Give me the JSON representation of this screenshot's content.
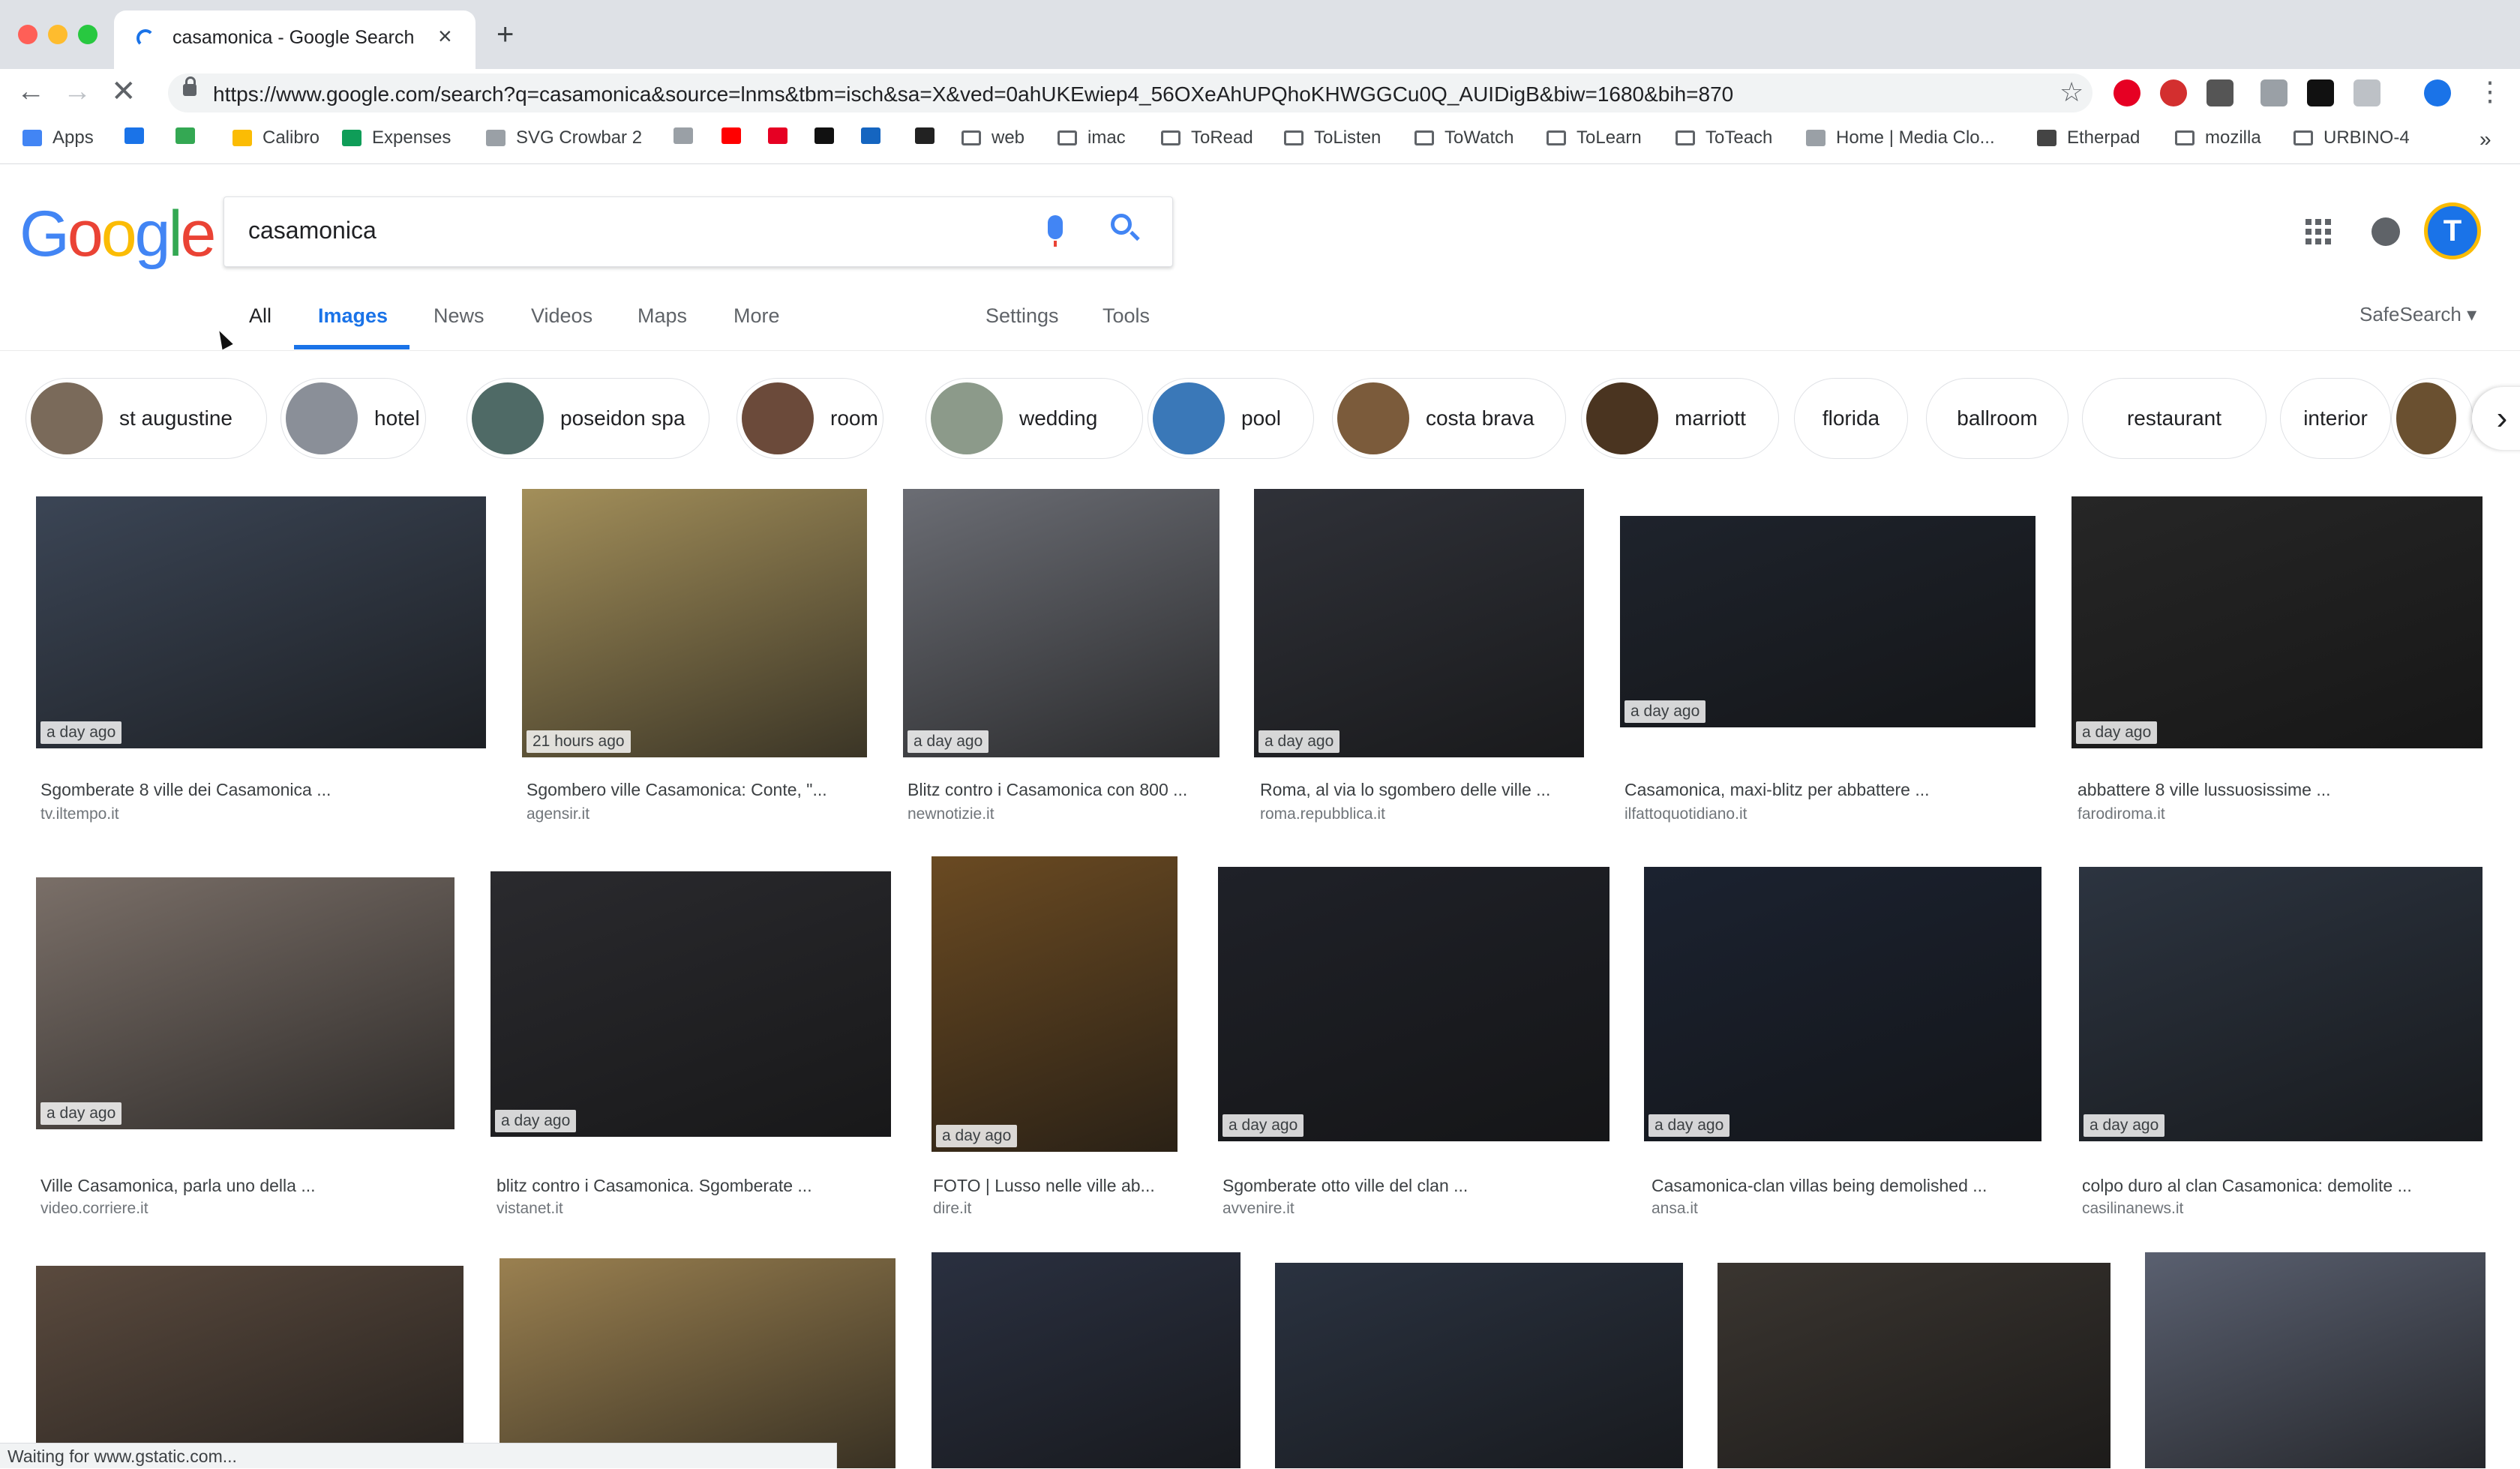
{
  "browser": {
    "tab_title": "casamonica - Google Search",
    "url": "https://www.google.com/search?q=casamonica&source=lnms&tbm=isch&sa=X&ved=0ahUKEwiep4_56OXeAhUPQhoKHWGGCu0Q_AUIDigB&biw=1680&bih=870",
    "status": "Waiting for www.gstatic.com..."
  },
  "bookmarks": [
    {
      "label": "Apps",
      "icon": "apps-grid-icon",
      "color": "#4285f4"
    },
    {
      "label": "",
      "icon": "calendar-icon",
      "color": "#1a73e8"
    },
    {
      "label": "",
      "icon": "drive-icon",
      "color": "#34a853"
    },
    {
      "label": "Calibro",
      "icon": "drive-icon",
      "color": "#fbbc04"
    },
    {
      "label": "Expenses",
      "icon": "sheets-icon",
      "color": "#0f9d58"
    },
    {
      "label": "SVG Crowbar 2",
      "icon": "page-icon",
      "color": "#9aa0a6"
    },
    {
      "label": "",
      "icon": "rss-icon",
      "color": "#9aa0a6"
    },
    {
      "label": "",
      "icon": "youtube-icon",
      "color": "#ff0000"
    },
    {
      "label": "",
      "icon": "pinterest-icon",
      "color": "#e60023"
    },
    {
      "label": "",
      "icon": "v-icon",
      "color": "#111111"
    },
    {
      "label": "",
      "icon": "t2-icon",
      "color": "#1565c0"
    },
    {
      "label": "",
      "icon": "image-icon",
      "color": "#222222"
    },
    {
      "label": "web",
      "icon": "folder-icon",
      "color": "#5f6368"
    },
    {
      "label": "imac",
      "icon": "folder-icon",
      "color": "#5f6368"
    },
    {
      "label": "ToRead",
      "icon": "folder-icon",
      "color": "#5f6368"
    },
    {
      "label": "ToListen",
      "icon": "folder-icon",
      "color": "#5f6368"
    },
    {
      "label": "ToWatch",
      "icon": "folder-icon",
      "color": "#5f6368"
    },
    {
      "label": "ToLearn",
      "icon": "folder-icon",
      "color": "#5f6368"
    },
    {
      "label": "ToTeach",
      "icon": "folder-icon",
      "color": "#5f6368"
    },
    {
      "label": "Home | Media Clo...",
      "icon": "page-icon",
      "color": "#9aa0a6"
    },
    {
      "label": "Etherpad",
      "icon": "etherpad-icon",
      "color": "#444444"
    },
    {
      "label": "mozilla",
      "icon": "folder-icon",
      "color": "#5f6368"
    },
    {
      "label": "URBINO-4",
      "icon": "folder-icon",
      "color": "#5f6368"
    }
  ],
  "bookmarks_overflow": "»",
  "search": {
    "query": "casamonica"
  },
  "logo_letters": [
    {
      "ch": "G",
      "color": "#4285f4"
    },
    {
      "ch": "o",
      "color": "#ea4335"
    },
    {
      "ch": "o",
      "color": "#fbbc05"
    },
    {
      "ch": "g",
      "color": "#4285f4"
    },
    {
      "ch": "l",
      "color": "#34a853"
    },
    {
      "ch": "e",
      "color": "#ea4335"
    }
  ],
  "avatar_letter": "T",
  "tabs": {
    "all": "All",
    "images": "Images",
    "news": "News",
    "videos": "Videos",
    "maps": "Maps",
    "more": "More",
    "settings": "Settings",
    "tools": "Tools",
    "safesearch": "SafeSearch ▾"
  },
  "chips": [
    {
      "label": "st augustine",
      "thumb": "#7a6a5a"
    },
    {
      "label": "hotel",
      "thumb": "#8a8f98"
    },
    {
      "label": "poseidon spa",
      "thumb": "#4f6a66"
    },
    {
      "label": "room",
      "thumb": "#6b4a3a"
    },
    {
      "label": "wedding",
      "thumb": "#8c9a8a"
    },
    {
      "label": "pool",
      "thumb": "#3a78b8"
    },
    {
      "label": "costa brava",
      "thumb": "#7b5b3b"
    },
    {
      "label": "marriott",
      "thumb": "#4a3420"
    },
    {
      "label": "florida",
      "thumb": ""
    },
    {
      "label": "ballroom",
      "thumb": ""
    },
    {
      "label": "restaurant",
      "thumb": ""
    },
    {
      "label": "interior",
      "thumb": ""
    },
    {
      "label": "",
      "thumb": "#6a5030"
    }
  ],
  "results": [
    {
      "time": "a day ago",
      "caption": "Sgomberate 8 ville dei Casamonica ...",
      "domain": "tv.iltempo.it",
      "color": "#3b4555"
    },
    {
      "time": "21 hours ago",
      "caption": "Sgombero ville Casamonica: Conte, \"...",
      "domain": "agensir.it",
      "color": "#a38f5a"
    },
    {
      "time": "a day ago",
      "caption": "Blitz contro i Casamonica con 800 ...",
      "domain": "newnotizie.it",
      "color": "#6b6d74"
    },
    {
      "time": "a day ago",
      "caption": "Roma, al via lo sgombero delle ville ...",
      "domain": "roma.repubblica.it",
      "color": "#2f3138"
    },
    {
      "time": "a day ago",
      "caption": "Casamonica, maxi-blitz per abbattere ...",
      "domain": "ilfattoquotidiano.it",
      "color": "#1e232c"
    },
    {
      "time": "a day ago",
      "caption": "abbattere 8 ville lussuosissime ...",
      "domain": "farodiroma.it",
      "color": "#262626"
    },
    {
      "time": "a day ago",
      "caption": "Ville Casamonica, parla uno della ...",
      "domain": "video.corriere.it",
      "color": "#7a6f68"
    },
    {
      "time": "a day ago",
      "caption": "blitz contro i Casamonica. Sgomberate ...",
      "domain": "vistanet.it",
      "color": "#2a2a2e"
    },
    {
      "time": "a day ago",
      "caption": "FOTO | Lusso nelle ville ab...",
      "domain": "dire.it",
      "color": "#6a4a22"
    },
    {
      "time": "a day ago",
      "caption": "Sgomberate otto ville del clan ...",
      "domain": "avvenire.it",
      "color": "#1f2128"
    },
    {
      "time": "a day ago",
      "caption": "Casamonica-clan villas being demolished ...",
      "domain": "ansa.it",
      "color": "#1b2230"
    },
    {
      "time": "a day ago",
      "caption": "colpo duro al clan Casamonica: demolite ...",
      "domain": "casilinanews.it",
      "color": "#2c3440"
    },
    {
      "time": "",
      "caption": "",
      "domain": "",
      "color": "#5a4a3e"
    },
    {
      "time": "",
      "caption": "",
      "domain": "",
      "color": "#9a8050"
    },
    {
      "time": "",
      "caption": "",
      "domain": "",
      "color": "#2a3040"
    },
    {
      "time": "",
      "caption": "",
      "domain": "",
      "color": "#2a3240"
    },
    {
      "time": "",
      "caption": "",
      "domain": "",
      "color": "#3a3530"
    },
    {
      "time": "",
      "caption": "",
      "domain": "",
      "color": "#5a6070"
    }
  ]
}
